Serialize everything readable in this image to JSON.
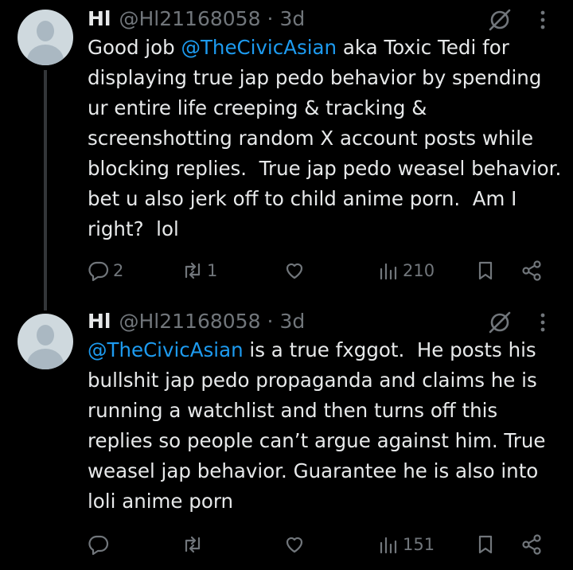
{
  "tweets": [
    {
      "display_name": "Hl",
      "handle": "@Hl21168058",
      "separator": "·",
      "time": "3d",
      "mention": "@TheCivicAsian",
      "text_before": "Good job ",
      "text_after": " aka Toxic Tedi for displaying true jap pedo behavior by spending ur entire life creeping & tracking & screenshotting random X account posts while blocking replies.  True jap pedo weasel behavior.  bet u also jerk off to child anime porn.  Am I right?  lol",
      "replies": "2",
      "reposts": "1",
      "likes": "",
      "views": "210"
    },
    {
      "display_name": "Hl",
      "handle": "@Hl21168058",
      "separator": "·",
      "time": "3d",
      "mention": "@TheCivicAsian",
      "text_before": "",
      "text_after": " is a true fxggot.  He posts his bullshit jap pedo propaganda and claims he is running a watchlist and then turns off this replies so people can’t argue against him. True weasel jap behavior. Guarantee he is also into loli anime porn",
      "replies": "",
      "reposts": "",
      "likes": "",
      "views": "151"
    }
  ],
  "icons": {
    "reply": "reply-icon",
    "repost": "repost-icon",
    "like": "heart-icon",
    "views": "views-icon",
    "bookmark": "bookmark-icon",
    "share": "share-icon",
    "grok": "grok-icon",
    "more": "more-icon"
  },
  "colors": {
    "background": "#000000",
    "text": "#e7e9ea",
    "muted": "#71767b",
    "link": "#1d9bf0",
    "thread_line": "#333639"
  }
}
